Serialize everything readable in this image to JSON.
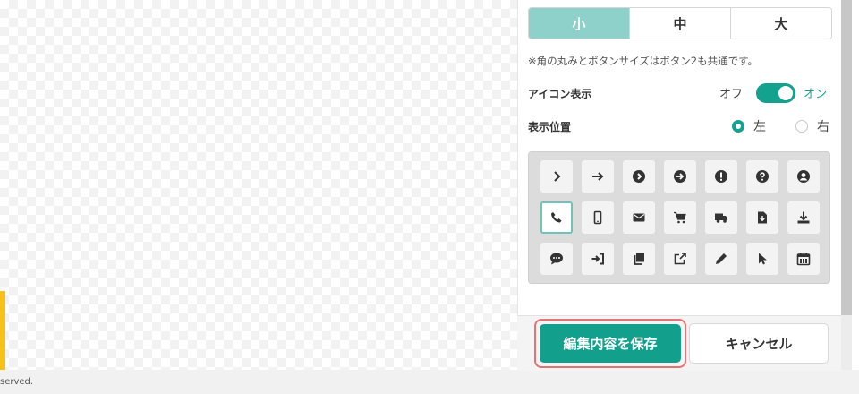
{
  "footer": {
    "text": "served."
  },
  "size_options": [
    {
      "label": "小",
      "active": true
    },
    {
      "label": "中",
      "active": false
    },
    {
      "label": "大",
      "active": false
    }
  ],
  "note": "※角の丸みとボタンサイズはボタン2も共通です。",
  "icon_display": {
    "label": "アイコン表示",
    "off_label": "オフ",
    "on_label": "オン",
    "state": "on"
  },
  "position": {
    "label": "表示位置",
    "options": [
      {
        "label": "左",
        "checked": true
      },
      {
        "label": "右",
        "checked": false
      }
    ]
  },
  "icons": [
    [
      "chevron-right-icon",
      "arrow-right-icon",
      "circle-chevron-right-icon",
      "circle-arrow-right-icon",
      "circle-exclamation-icon",
      "circle-question-icon",
      "user-circle-icon"
    ],
    [
      "phone-icon",
      "mobile-icon",
      "envelope-icon",
      "cart-icon",
      "truck-icon",
      "file-download-icon",
      "download-icon"
    ],
    [
      "chat-icon",
      "sign-in-icon",
      "copy-icon",
      "external-link-icon",
      "pencil-icon",
      "pointer-icon",
      "calendar-icon"
    ]
  ],
  "selected_icon": "phone-icon",
  "buttons": {
    "save": "編集内容を保存",
    "cancel": "キャンセル"
  }
}
